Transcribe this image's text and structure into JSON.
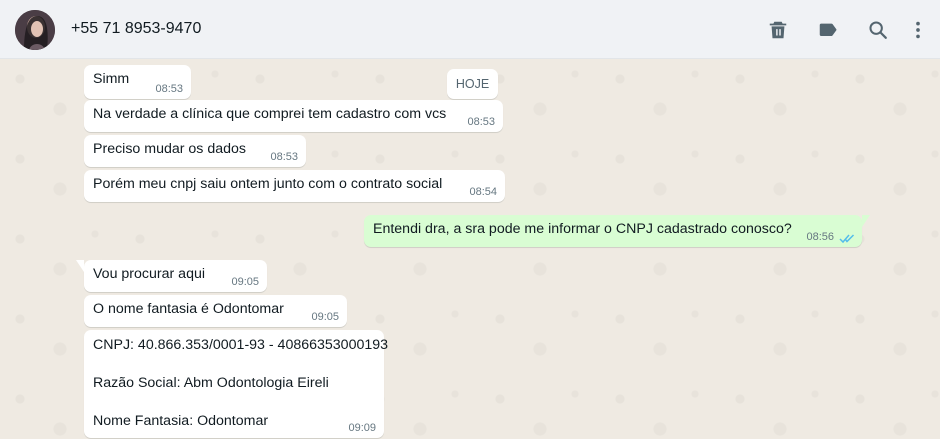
{
  "header": {
    "contact_name": "+55 71 8953-9470",
    "icons": [
      "delete-icon",
      "label-icon",
      "search-icon",
      "menu-icon"
    ]
  },
  "chat": {
    "day_badge": "HOJE",
    "messages": [
      {
        "direction": "in",
        "text": "Simm",
        "time": "08:53"
      },
      {
        "direction": "in",
        "text": "Na verdade a clínica que comprei tem cadastro com vcs",
        "time": "08:53"
      },
      {
        "direction": "in",
        "text": "Preciso mudar os dados",
        "time": "08:53"
      },
      {
        "direction": "in",
        "text": "Porém meu cnpj saiu ontem junto com o contrato social",
        "time": "08:54"
      },
      {
        "direction": "out",
        "text": "Entendi dra, a sra pode me informar o CNPJ cadastrado conosco?",
        "time": "08:56",
        "status": "read"
      },
      {
        "direction": "in",
        "text": "Vou procurar aqui",
        "time": "09:05"
      },
      {
        "direction": "in",
        "text": "O nome fantasia é Odontomar",
        "time": "09:05"
      },
      {
        "direction": "in",
        "lines": [
          "CNPJ: 40.866.353/0001-93 - 40866353000193",
          "Razão Social: Abm Odontologia Eireli",
          "Nome Fantasia: Odontomar"
        ],
        "time": "09:09"
      }
    ]
  },
  "colors": {
    "header_bg": "#f0f2f5",
    "chat_bg": "#efeae2",
    "incoming_bubble": "#ffffff",
    "outgoing_bubble": "#d9fdd3",
    "read_ticks": "#53bdeb"
  }
}
